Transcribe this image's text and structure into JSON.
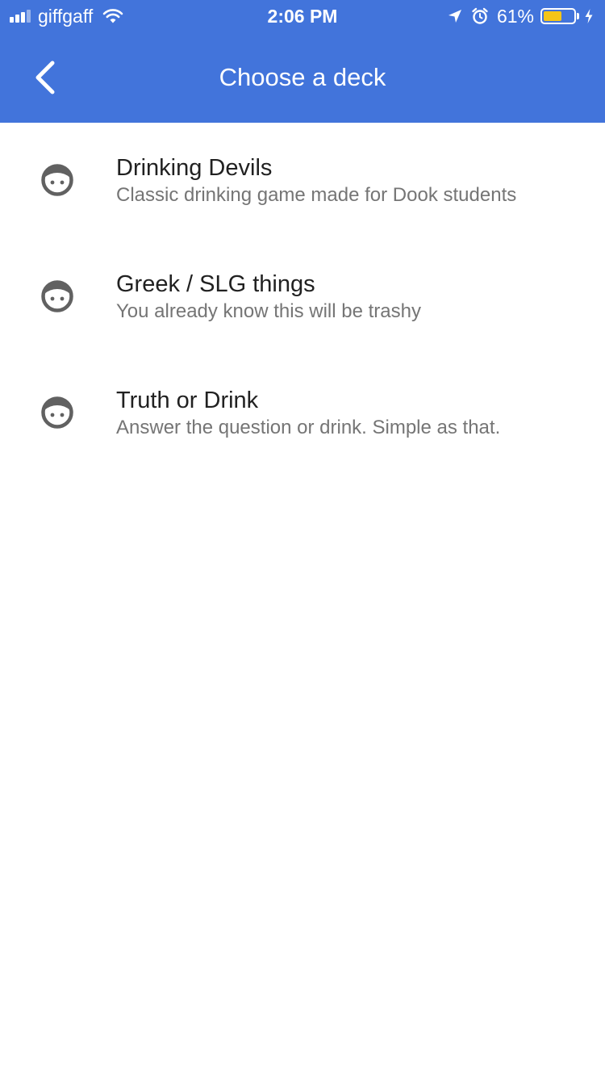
{
  "status_bar": {
    "carrier": "giffgaff",
    "time": "2:06 PM",
    "battery_percent": "61%",
    "battery_level": 0.61,
    "battery_color": "#f5c518",
    "icons": [
      "signal-icon",
      "wifi-icon",
      "location-arrow-icon",
      "alarm-icon",
      "battery-icon",
      "charging-bolt-icon"
    ]
  },
  "header": {
    "title": "Choose a deck",
    "back_icon": "chevron-left-icon",
    "background_color": "#4274db"
  },
  "decks": [
    {
      "title": "Drinking Devils",
      "subtitle": "Classic drinking game made for Dook students",
      "icon": "face-icon"
    },
    {
      "title": "Greek / SLG things",
      "subtitle": "You already know this will be trashy",
      "icon": "face-icon"
    },
    {
      "title": "Truth or Drink",
      "subtitle": "Answer the question or drink. Simple as that.",
      "icon": "face-icon"
    }
  ]
}
